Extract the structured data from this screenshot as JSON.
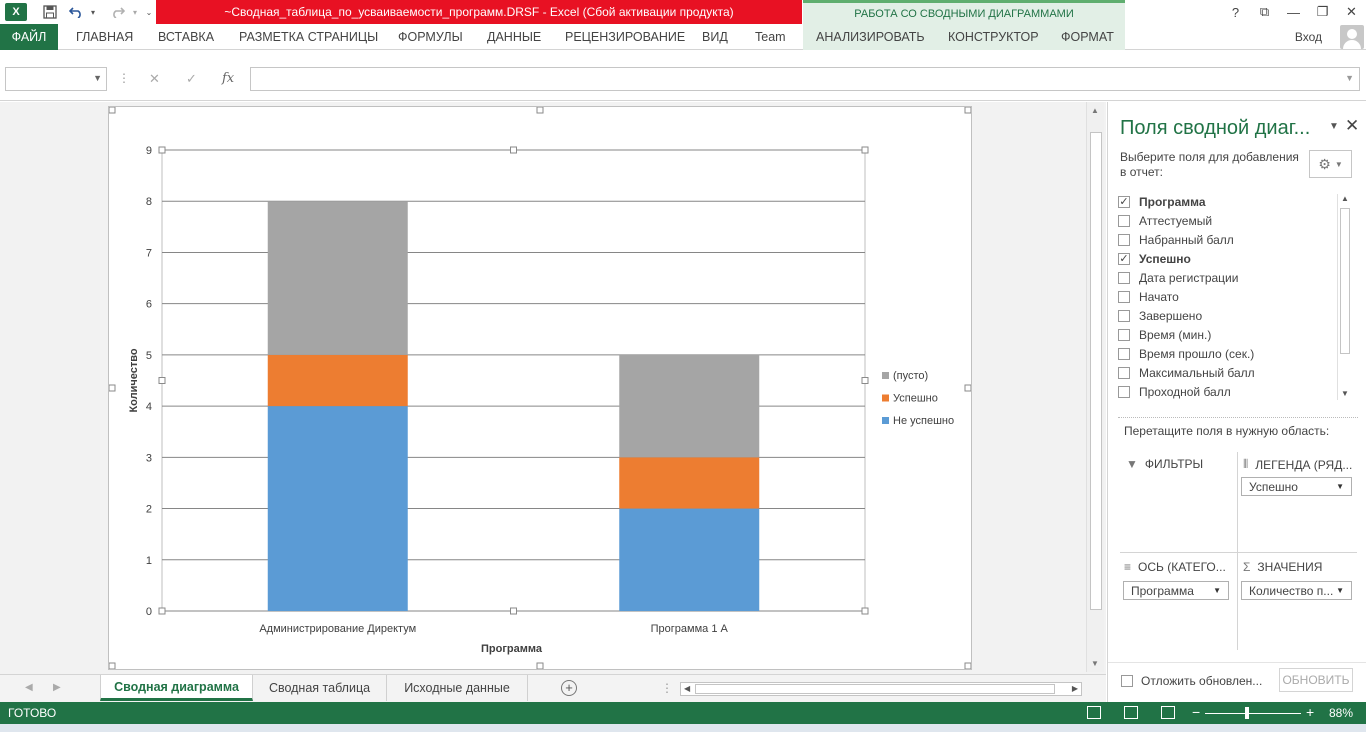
{
  "app": {
    "title": "~Сводная_таблица_по_усваиваемости_программ.DRSF -  Excel (Сбой активации продукта)",
    "context_header": "РАБОТА СО СВОДНЫМИ ДИАГРАММАМИ",
    "logo_letter": "X",
    "window_buttons": [
      "?",
      "⧉",
      "—",
      "❐",
      "✕"
    ]
  },
  "ribbon": {
    "file_tab": "ФАЙЛ",
    "tabs": [
      "ГЛАВНАЯ",
      "ВСТАВКА",
      "РАЗМЕТКА СТРАНИЦЫ",
      "ФОРМУЛЫ",
      "ДАННЫЕ",
      "РЕЦЕНЗИРОВАНИЕ",
      "ВИД",
      "Team"
    ],
    "context_tabs": [
      "АНАЛИЗИРОВАТЬ",
      "КОНСТРУКТОР",
      "ФОРМАТ"
    ],
    "signin": "Вход"
  },
  "formula_bar": {
    "name_box": "",
    "formula": "",
    "cancel_icon": "✕",
    "enter_icon": "✓",
    "fx_label": "fx"
  },
  "chart_data": {
    "type": "bar",
    "stacked": true,
    "categories": [
      "Администрирование Директум",
      "Программа 1 А"
    ],
    "series": [
      {
        "name": "Не успешно",
        "values": [
          4,
          2
        ],
        "color": "#5b9bd5"
      },
      {
        "name": "Успешно",
        "values": [
          1,
          1
        ],
        "color": "#ed7d31"
      },
      {
        "name": "(пусто)",
        "values": [
          3,
          2
        ],
        "color": "#a5a5a5"
      }
    ],
    "xlabel": "Программа",
    "ylabel": "Количество",
    "ylim": [
      0,
      9
    ],
    "yticks": [
      "0",
      "1",
      "2",
      "3",
      "4",
      "5",
      "6",
      "7",
      "8",
      "9"
    ],
    "grid": true,
    "legend_position": "right"
  },
  "sheets": {
    "tabs": [
      "Сводная диаграмма",
      "Сводная таблица",
      "Исходные данные"
    ],
    "active": 0
  },
  "status": {
    "text": "ГОТОВО",
    "zoom": "88%",
    "zoom_minus": "−",
    "zoom_plus": "+"
  },
  "pane": {
    "title": "Поля сводной диаг...",
    "subtitle": "Выберите поля для добавления в отчет:",
    "fields": [
      {
        "label": "Программа",
        "checked": true
      },
      {
        "label": "Аттестуемый",
        "checked": false
      },
      {
        "label": "Набранный балл",
        "checked": false
      },
      {
        "label": "Успешно",
        "checked": true
      },
      {
        "label": "Дата регистрации",
        "checked": false
      },
      {
        "label": "Начато",
        "checked": false
      },
      {
        "label": "Завершено",
        "checked": false
      },
      {
        "label": "Время (мин.)",
        "checked": false
      },
      {
        "label": "Время прошло (сек.)",
        "checked": false
      },
      {
        "label": "Максимальный балл",
        "checked": false
      },
      {
        "label": "Проходной балл",
        "checked": false
      }
    ],
    "drag_label": "Перетащите поля в нужную область:",
    "areas": {
      "filters": {
        "label": "ФИЛЬТРЫ",
        "items": []
      },
      "legend": {
        "label": "ЛЕГЕНДА (РЯД...",
        "items": [
          "Успешно"
        ]
      },
      "axis": {
        "label": "ОСЬ (КАТЕГО...",
        "items": [
          "Программа"
        ]
      },
      "values": {
        "label": "ЗНАЧЕНИЯ",
        "items": [
          "Количество п..."
        ]
      }
    },
    "defer_label": "Отложить обновлен...",
    "update_button": "ОБНОВИТЬ"
  }
}
